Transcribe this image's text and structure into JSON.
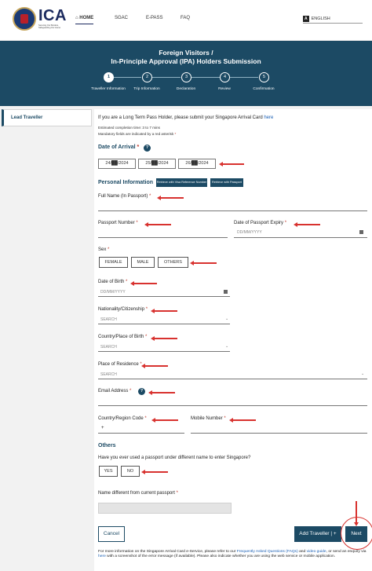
{
  "header": {
    "logo_text": "ICA",
    "logo_tagline": "Securing Our Borders, Safeguarding Our Home",
    "nav": [
      {
        "label": "HOME",
        "icon": "home-icon",
        "active": true
      },
      {
        "label": "SGAC",
        "active": false
      },
      {
        "label": "E-PASS",
        "active": false
      },
      {
        "label": "FAQ",
        "active": false
      }
    ],
    "language": {
      "badge": "A",
      "value": "ENGLISH"
    }
  },
  "banner": {
    "title_line1": "Foreign Visitors /",
    "title_line2": "In-Principle Approval (IPA) Holders Submission",
    "steps": [
      {
        "number": "1",
        "label": "Traveller Information",
        "active": true
      },
      {
        "number": "2",
        "label": "Trip Information",
        "active": false
      },
      {
        "number": "3",
        "label": "Declaration",
        "active": false
      },
      {
        "number": "4",
        "label": "Review",
        "active": false
      },
      {
        "number": "5",
        "label": "Confirmation",
        "active": false
      }
    ]
  },
  "sidebar": {
    "items": [
      {
        "label": "Lead Traveller",
        "active": true
      }
    ]
  },
  "form": {
    "ltp_text": "If you are a Long Term Pass Holder, please submit your Singapore Arrival Card",
    "ltp_link": "here",
    "est_time": "Estimated completion time: 3 to 7 mins",
    "mandatory_note": "Mandatory fields are indicated by a red asterisk",
    "arrival_label": "Date of Arrival",
    "arrival_dates": [
      "24/██/2024",
      "25/██/2024",
      "26/██/2024"
    ],
    "personal_info": "Personal Information",
    "retrieve_visa": "Retrieve with Visa Reference Number",
    "retrieve_passport": "Retrieve with Passport",
    "full_name_label": "Full Name (In Passport)",
    "passport_number_label": "Passport Number",
    "passport_expiry_label": "Date of Passport Expiry",
    "date_placeholder": "DD/MM/YYYY",
    "sex_label": "Sex",
    "sex_options": [
      "FEMALE",
      "MALE",
      "OTHERS"
    ],
    "dob_label": "Date of Birth",
    "nationality_label": "Nationality/Citizenship",
    "search_placeholder": "SEARCH",
    "birth_place_label": "Country/Place of Birth",
    "residence_label": "Place of Residence",
    "email_label": "Email Address",
    "region_code_label": "Country/Region Code",
    "region_code_prefix": "+",
    "mobile_label": "Mobile Number",
    "others_heading": "Others",
    "diff_passport_q": "Have you ever used a passport under different name to enter Singapore?",
    "yes_no": [
      "YES",
      "NO"
    ],
    "name_diff_label": "Name different from current passport",
    "asterisk": "*",
    "help_glyph": "?"
  },
  "actions": {
    "cancel": "Cancel",
    "add_traveller": "Add Traveller | +",
    "next": "Next"
  },
  "footer": {
    "text1": "For more information on the Singapore Arrival Card e-Service, please refer to our",
    "faq_link": "Frequently Asked Questions (FAQs)",
    "and": "and",
    "guide_link": "video guide",
    "text2": ", or send an enquiry via",
    "here_link": "here",
    "text3": "with a screenshot of the error message (if available). Please also indicate whether you are using the web service or mobile application."
  },
  "colors": {
    "primary": "#1c4a64",
    "annotation": "#d8322f",
    "link": "#1a5fb4"
  }
}
